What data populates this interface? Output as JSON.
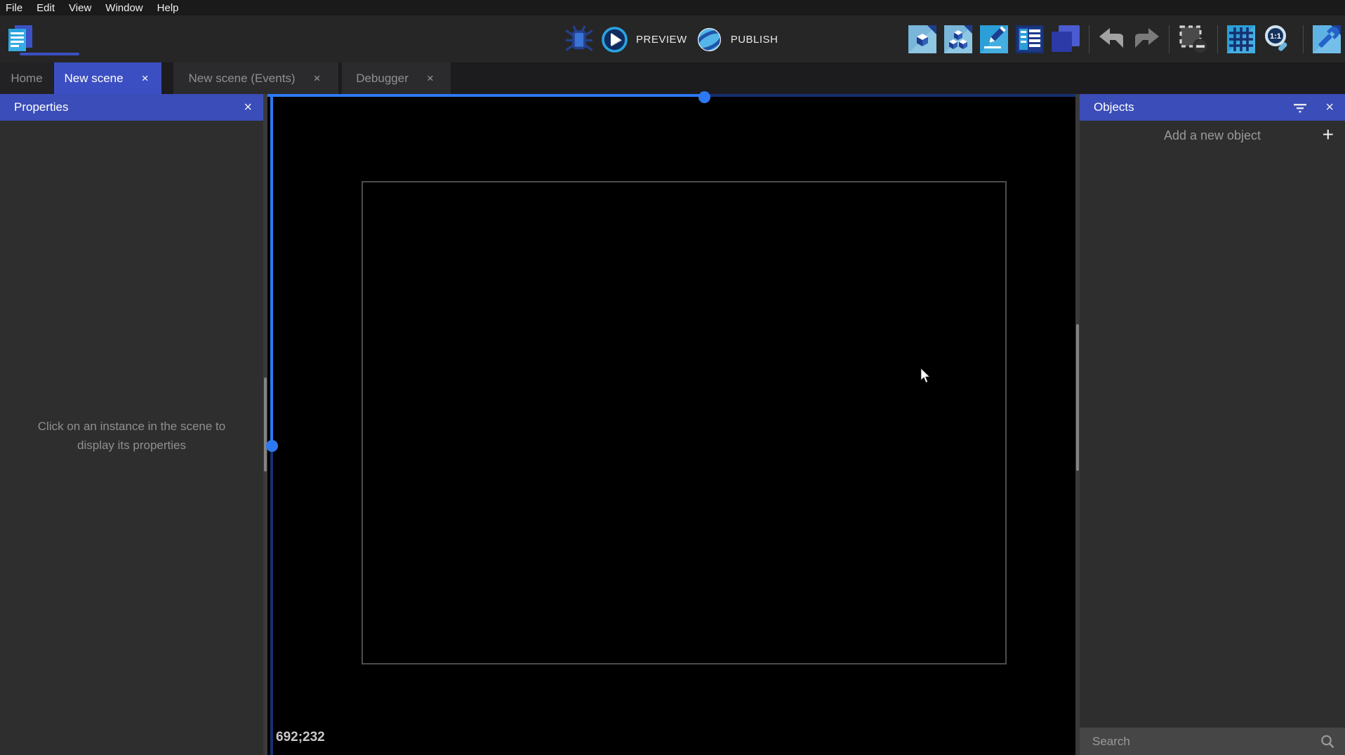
{
  "menu": {
    "items": [
      "File",
      "Edit",
      "View",
      "Window",
      "Help"
    ]
  },
  "toolbar": {
    "preview_label": "PREVIEW",
    "publish_label": "PUBLISH"
  },
  "tabs": [
    {
      "label": "Home",
      "active": false
    },
    {
      "label": "New scene",
      "active": true
    },
    {
      "label": "New scene (Events)",
      "active": false
    },
    {
      "label": "Debugger",
      "active": false
    }
  ],
  "ui": {
    "close_glyph": "×",
    "plus_glyph": "+"
  },
  "properties_panel": {
    "title": "Properties",
    "empty_message": "Click on an instance in the scene to display its properties"
  },
  "objects_panel": {
    "title": "Objects",
    "add_label": "Add a new object",
    "search_placeholder": "Search"
  },
  "canvas": {
    "cursor_coordinates": "692;232"
  },
  "colors": {
    "panel_header_blue": "#3b4db8",
    "active_tab_blue": "#3c4fc2",
    "scrollbar_active_blue": "#2d79f3",
    "scrollbar_inactive_blue": "#15306f",
    "panel_background": "#2e2e2e",
    "toolbar_background": "#262626",
    "canvas_background": "#000000",
    "search_bar_background": "#464646"
  },
  "icons": {
    "filter": "filter-lines",
    "search": "magnifier",
    "zoom_reset": "1:1"
  }
}
